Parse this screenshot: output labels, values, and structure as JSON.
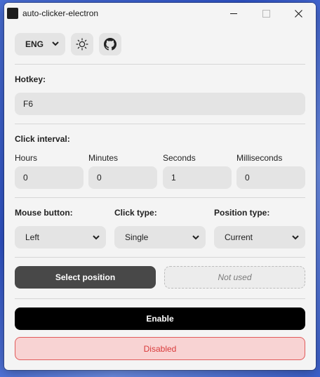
{
  "window": {
    "title": "auto-clicker-electron"
  },
  "topbar": {
    "language": "ENG"
  },
  "hotkey": {
    "label": "Hotkey:",
    "value": "F6"
  },
  "interval": {
    "label": "Click interval:",
    "fields": [
      {
        "label": "Hours",
        "value": "0"
      },
      {
        "label": "Minutes",
        "value": "0"
      },
      {
        "label": "Seconds",
        "value": "1"
      },
      {
        "label": "Milliseconds",
        "value": "0"
      }
    ]
  },
  "options": {
    "mouse_button": {
      "label": "Mouse button:",
      "value": "Left"
    },
    "click_type": {
      "label": "Click type:",
      "value": "Single"
    },
    "position_type": {
      "label": "Position type:",
      "value": "Current"
    }
  },
  "position": {
    "select_label": "Select position",
    "placeholder": "Not used"
  },
  "actions": {
    "enable_label": "Enable",
    "status": "Disabled"
  },
  "colors": {
    "enable_bg": "#000000",
    "select_position_bg": "#484848",
    "status_bg": "#f8d3d3",
    "status_border": "#e15a5a",
    "status_text": "#d93b3b"
  },
  "icons": {
    "app": "app-icon",
    "theme": "sun-icon",
    "github": "github-icon",
    "dropdown": "chevron-down-icon"
  }
}
